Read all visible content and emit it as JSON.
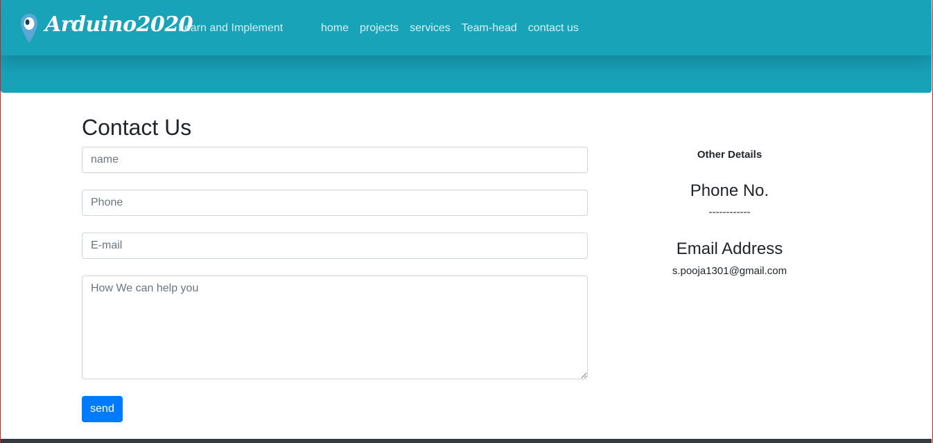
{
  "header": {
    "brand": "Arduino2020",
    "tagline": "Learn and Implement",
    "logo_icon": "map-pin-icon",
    "colors": {
      "header_bg": "#18a2b8",
      "brand_text": "#ffffff",
      "nav_text": "#d6f1f5"
    },
    "nav": [
      {
        "label": "home"
      },
      {
        "label": "projects"
      },
      {
        "label": "services"
      },
      {
        "label": "Team-head"
      },
      {
        "label": "contact us"
      }
    ]
  },
  "contact": {
    "title": "Contact Us",
    "fields": {
      "name": {
        "placeholder": "name",
        "value": ""
      },
      "phone": {
        "placeholder": "Phone",
        "value": ""
      },
      "email": {
        "placeholder": "E-mail",
        "value": ""
      },
      "message": {
        "placeholder": "How We can help you",
        "value": ""
      }
    },
    "send_label": "send",
    "send_color": "#007bff"
  },
  "details": {
    "title": "Other Details",
    "phone_heading": "Phone No.",
    "phone_value": "------------",
    "email_heading": "Email Address",
    "email_value": "s.pooja1301@gmail.com"
  }
}
